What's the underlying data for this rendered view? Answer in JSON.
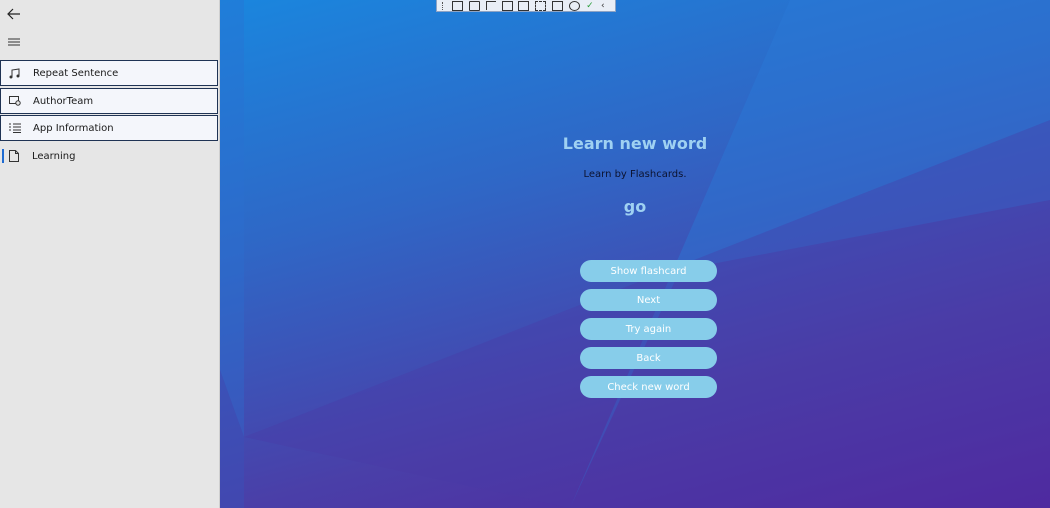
{
  "nav": {
    "items": [
      {
        "label": "Repeat Sentence",
        "icon": "music-note-icon"
      },
      {
        "label": "AuthorTeam",
        "icon": "team-card-icon"
      },
      {
        "label": "App Information",
        "icon": "list-icon"
      },
      {
        "label": "Learning",
        "icon": "document-icon"
      }
    ],
    "active_item": "Learning"
  },
  "main": {
    "title": "Learn new word",
    "subtitle": "Learn by Flashcards.",
    "word": "go",
    "buttons": [
      {
        "label": "Show flashcard"
      },
      {
        "label": "Next"
      },
      {
        "label": "Try again"
      },
      {
        "label": "Back"
      },
      {
        "label": "Check new word"
      }
    ]
  },
  "colors": {
    "title_text": "#9fd1f2",
    "button_bg": "#87cdea",
    "active_indicator": "#1f6bd1"
  }
}
